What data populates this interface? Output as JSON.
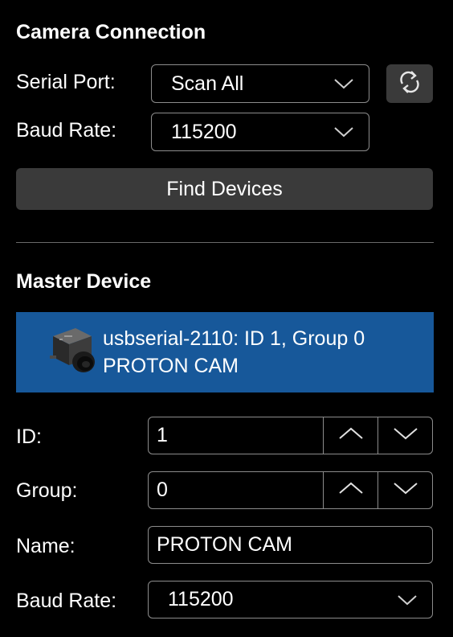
{
  "camera_connection": {
    "title": "Camera Connection",
    "serial_port_label": "Serial Port:",
    "serial_port_value": "Scan All",
    "baud_rate_label": "Baud Rate:",
    "baud_rate_value": "115200",
    "find_devices_label": "Find Devices"
  },
  "master_device": {
    "title": "Master Device",
    "device": {
      "line1": "usbserial-2110: ID 1, Group 0",
      "line2": "PROTON CAM"
    },
    "id_label": "ID:",
    "id_value": "1",
    "group_label": "Group:",
    "group_value": "0",
    "name_label": "Name:",
    "name_value": "PROTON CAM",
    "baud_rate_label": "Baud Rate:",
    "baud_rate_value": "115200"
  },
  "colors": {
    "background": "#000000",
    "device_selected": "#17589a",
    "button_dark": "#3a3a3a",
    "border": "#8c8c8c"
  },
  "icons": [
    "refresh-icon",
    "chevron-down-icon",
    "chevron-up-icon",
    "camera-icon"
  ]
}
